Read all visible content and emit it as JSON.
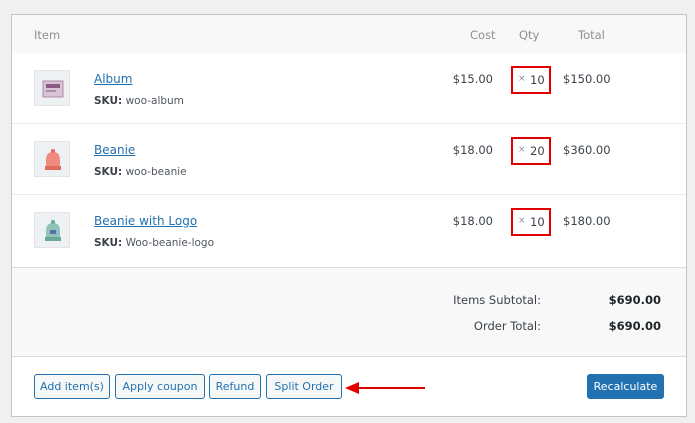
{
  "columns": {
    "item": "Item",
    "cost": "Cost",
    "qty": "Qty",
    "total": "Total"
  },
  "items": [
    {
      "name": "Album",
      "sku_label": "SKU:",
      "sku": "woo-album",
      "cost": "$15.00",
      "qty_symbol": "×",
      "qty": "10",
      "total": "$150.00",
      "thumb_icon": "album-thumbnail"
    },
    {
      "name": "Beanie",
      "sku_label": "SKU:",
      "sku": "woo-beanie",
      "cost": "$18.00",
      "qty_symbol": "×",
      "qty": "20",
      "total": "$360.00",
      "thumb_icon": "beanie-thumbnail"
    },
    {
      "name": "Beanie with Logo",
      "sku_label": "SKU:",
      "sku": "Woo-beanie-logo",
      "cost": "$18.00",
      "qty_symbol": "×",
      "qty": "10",
      "total": "$180.00",
      "thumb_icon": "beanie-logo-thumbnail"
    }
  ],
  "totals": {
    "subtotal_label": "Items Subtotal:",
    "subtotal_value": "$690.00",
    "order_total_label": "Order Total:",
    "order_total_value": "$690.00"
  },
  "actions": {
    "add_items": "Add item(s)",
    "apply_coupon": "Apply coupon",
    "refund": "Refund",
    "split_order": "Split Order",
    "recalculate": "Recalculate"
  },
  "colors": {
    "link": "#2271b1",
    "highlight": "#e00000",
    "primary": "#2271b1"
  }
}
